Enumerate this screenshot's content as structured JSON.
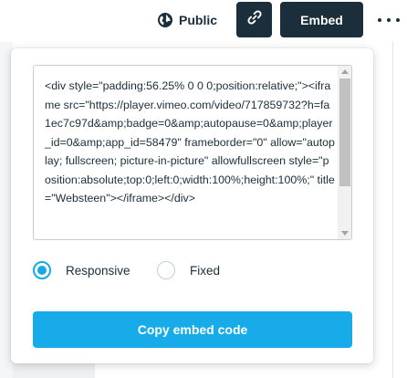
{
  "header": {
    "public_label": "Public",
    "public_icon": "globe-icon",
    "link_icon": "link-icon",
    "embed_label": "Embed",
    "more_icon": "more-horizontal-icon"
  },
  "embed_panel": {
    "code": "<div style=\"padding:56.25% 0 0 0;position:relative;\"><iframe src=\"https://player.vimeo.com/video/717859732?h=fa1ec7c97d&amp;badge=0&amp;autopause=0&amp;player_id=0&amp;app_id=58479\" frameborder=\"0\" allow=\"autoplay; fullscreen; picture-in-picture\" allowfullscreen style=\"position:absolute;top:0;left:0;width:100%;height:100%;\" title=\"Websteen\"></iframe></div>",
    "options": [
      {
        "label": "Responsive",
        "selected": true
      },
      {
        "label": "Fixed",
        "selected": false
      }
    ],
    "copy_label": "Copy embed code"
  },
  "colors": {
    "dark": "#1a2e3b",
    "accent": "#17abea"
  }
}
